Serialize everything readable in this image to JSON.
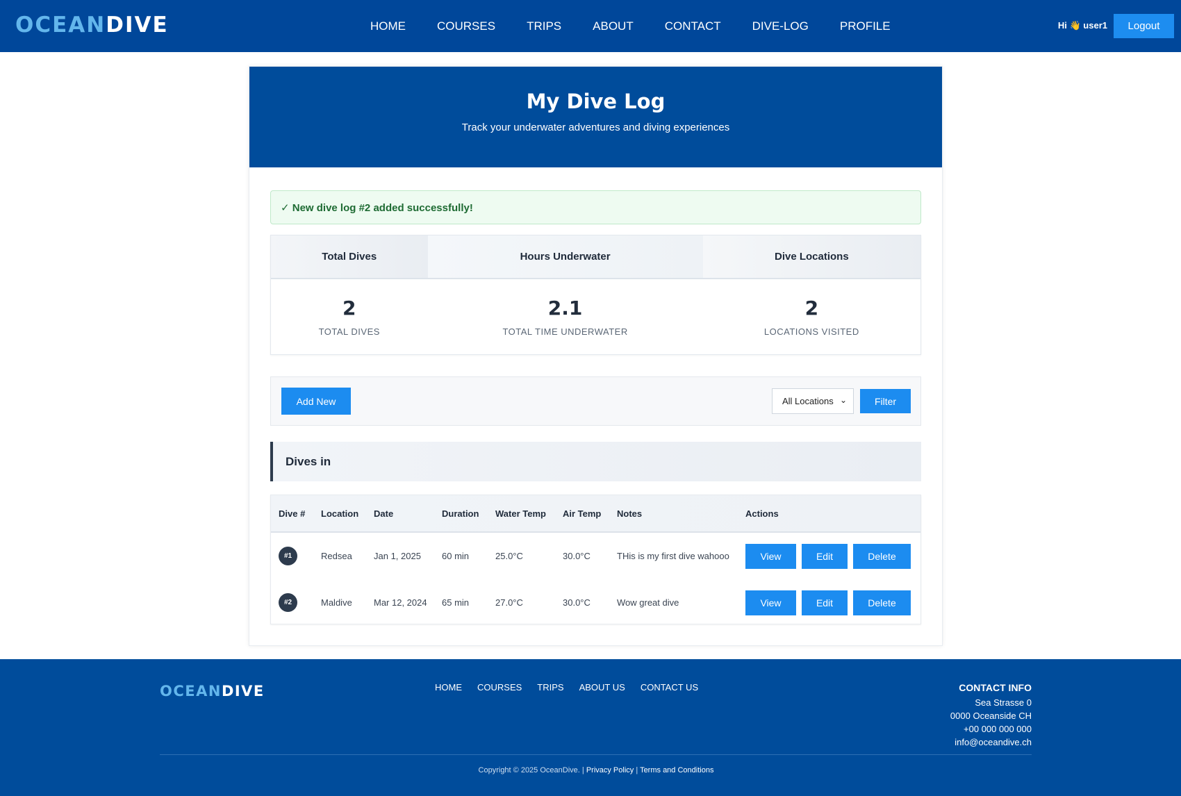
{
  "brand": {
    "part1": "OCEAN",
    "part2": "DIVE"
  },
  "nav": [
    "HOME",
    "COURSES",
    "TRIPS",
    "ABOUT",
    "CONTACT",
    "DIVE-LOG",
    "PROFILE"
  ],
  "user": {
    "greeting": "Hi 👋 user1",
    "logout_label": "Logout"
  },
  "hero": {
    "title": "My Dive Log",
    "subtitle": "Track your underwater adventures and diving experiences"
  },
  "alert": "✓ New dive log #2 added successfully!",
  "stats": {
    "headers": [
      "Total Dives",
      "Hours Underwater",
      "Dive Locations"
    ],
    "values": [
      "2",
      "2.1",
      "2"
    ],
    "labels": [
      "TOTAL DIVES",
      "TOTAL TIME UNDERWATER",
      "LOCATIONS VISITED"
    ]
  },
  "toolbar": {
    "add_label": "Add New",
    "location_select": "All Locations",
    "filter_label": "Filter"
  },
  "dives_heading": "Dives in",
  "table": {
    "columns": [
      "Dive #",
      "Location",
      "Date",
      "Duration",
      "Water Temp",
      "Air Temp",
      "Notes",
      "Actions"
    ],
    "rows": [
      {
        "num": "#1",
        "location": "Redsea",
        "date": "Jan 1, 2025",
        "duration": "60 min",
        "water": "25.0°C",
        "air": "30.0°C",
        "notes": "THis is my first dive wahooo"
      },
      {
        "num": "#2",
        "location": "Maldive",
        "date": "Mar 12, 2024",
        "duration": "65 min",
        "water": "27.0°C",
        "air": "30.0°C",
        "notes": "Wow great dive"
      }
    ],
    "actions": {
      "view": "View",
      "edit": "Edit",
      "delete": "Delete"
    }
  },
  "footer": {
    "nav": [
      "HOME",
      "COURSES",
      "TRIPS",
      "ABOUT US",
      "CONTACT US"
    ],
    "contact_title": "CONTACT INFO",
    "contact_lines": [
      "Sea Strasse 0",
      "0000 Oceanside CH",
      "+00 000 000 000",
      "info@oceandive.ch"
    ],
    "copyright": "Copyright © 2025 OceanDive. |",
    "privacy": "Privacy Policy",
    "sep": "|",
    "terms": "Terms and Conditions"
  }
}
